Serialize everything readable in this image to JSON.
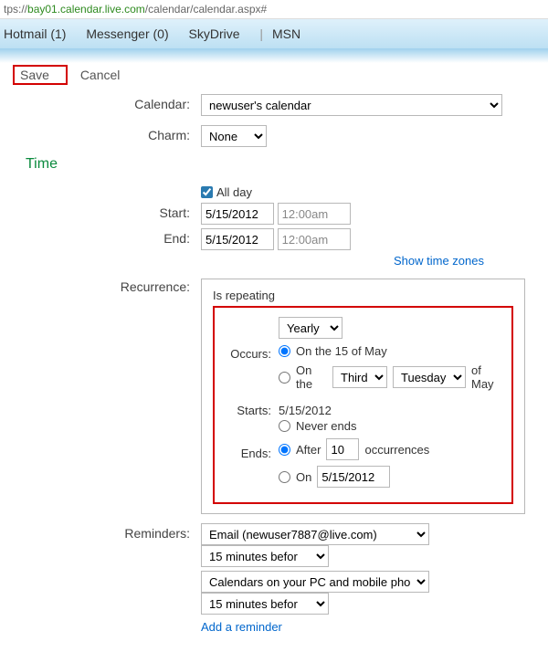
{
  "url": {
    "prefix": "tps://",
    "host": "bay01.calendar.live.com",
    "path": "/calendar/calendar.aspx#"
  },
  "nav": {
    "hotmail": "Hotmail (1)",
    "messenger": "Messenger (0)",
    "skydrive": "SkyDrive",
    "msn": "MSN"
  },
  "toolbar": {
    "save": "Save",
    "cancel": "Cancel"
  },
  "labels": {
    "calendar": "Calendar:",
    "charm": "Charm:",
    "time": "Time",
    "start": "Start:",
    "end": "End:",
    "allday": "All day",
    "show_tz": "Show time zones",
    "recurrence": "Recurrence:",
    "is_repeating": "Is repeating",
    "occurs": "Occurs:",
    "starts": "Starts:",
    "ends": "Ends:",
    "reminders": "Reminders:",
    "add_reminder": "Add a reminder"
  },
  "calendar_sel": "newuser's calendar",
  "charm_sel": "None",
  "start_date": "5/15/2012",
  "start_time": "12:00am",
  "end_date": "5/15/2012",
  "end_time": "12:00am",
  "occurs_sel": "Yearly",
  "on_fixed": "On the 15 of May",
  "on_nth_prefix": "On the",
  "on_nth_ord": "Third",
  "on_nth_day": "Tuesday",
  "on_nth_suffix": "of May",
  "starts_value": "5/15/2012",
  "never_ends": "Never ends",
  "after_prefix": "After",
  "after_count": "10",
  "after_suffix": "occurrences",
  "on_date_prefix": "On",
  "on_date_value": "5/15/2012",
  "reminder1_method": "Email (newuser7887@live.com)",
  "reminder1_time": "15 minutes befor",
  "reminder2_method": "Calendars on your PC and mobile phone",
  "reminder2_time": "15 minutes befor"
}
